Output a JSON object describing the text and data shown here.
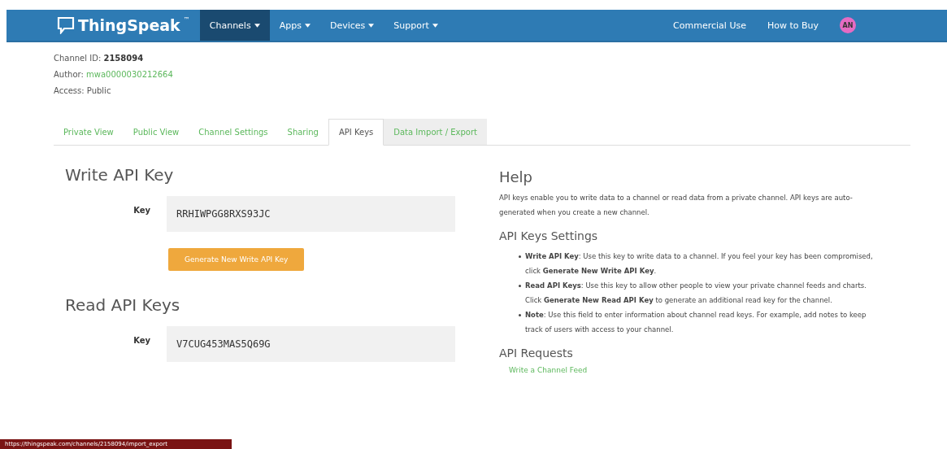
{
  "navbar": {
    "logo": "ThingSpeak",
    "trademark": "™",
    "menus": [
      {
        "label": "Channels",
        "selected": true
      },
      {
        "label": "Apps",
        "selected": false
      },
      {
        "label": "Devices",
        "selected": false
      },
      {
        "label": "Support",
        "selected": false
      }
    ],
    "right_links": [
      "Commercial Use",
      "How to Buy"
    ],
    "avatar": "AN"
  },
  "channel_info": {
    "id_label": "Channel ID:",
    "id": "2158094",
    "author_label": "Author:",
    "author": "mwa0000030212664",
    "access": "Access: Public"
  },
  "tabs": [
    {
      "label": "Private View",
      "selected": false
    },
    {
      "label": "Public View",
      "selected": false
    },
    {
      "label": "Channel Settings",
      "selected": false
    },
    {
      "label": "Sharing",
      "selected": false
    },
    {
      "label": "API Keys",
      "selected": true
    },
    {
      "label": "Data Import / Export",
      "selected": false
    }
  ],
  "write_key": {
    "title": "Write API Key",
    "key_label": "Key",
    "value": "RRHIWPGG8RXS93JC",
    "button": "Generate New Write API Key"
  },
  "read_keys": {
    "title": "Read API Keys",
    "key_label": "Key",
    "value": "V7CUG453MAS5Q69G"
  },
  "help": {
    "title": "Help",
    "intro": "API keys enable you to write data to a channel or read data from a private channel. API keys are auto-generated when you create a new channel.",
    "settings_title": "API Keys Settings",
    "bullets": [
      "**Write API Key**: Use this key to write data to a channel. If you feel your key has been compromised, click **Generate New Write API Key**.",
      "**Read API Keys**: Use this key to allow other people to view your private channel feeds and charts. Click **Generate New Read API Key** to generate an additional read key for the channel.",
      "**Note**: Use this field to enter information about channel read keys. For example, add notes to keep track of users with access to your channel."
    ],
    "requests_title": "API Requests",
    "request_link": "Write a Channel Feed"
  },
  "status_url": "https://thingspeak.com/channels/2158094/import_export"
}
